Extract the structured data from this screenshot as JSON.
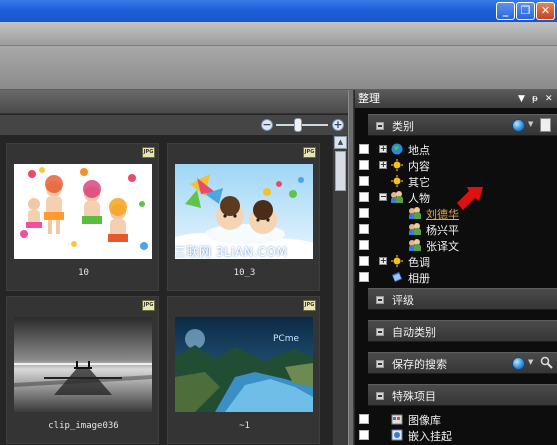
{
  "window": {
    "buttons": [
      {
        "glyph": "_",
        "name": "minimize"
      },
      {
        "glyph": "❐",
        "name": "restore"
      },
      {
        "glyph": "✕",
        "name": "close"
      }
    ]
  },
  "browser": {
    "zoom": {
      "minus": "−",
      "plus": "+"
    },
    "thumbnails": [
      {
        "caption": "10",
        "format": "JPG"
      },
      {
        "caption": "10_3",
        "format": "JPG"
      },
      {
        "caption": "clip_image036",
        "format": "JPG"
      },
      {
        "caption": "~1",
        "format": "JPG"
      }
    ],
    "watermark": "三联网 3LIAN.COM",
    "photo_logo": "PCme"
  },
  "organize": {
    "title": "整理",
    "controls": {
      "dropdown": "▼",
      "pin": "ᵽ",
      "close": "✕"
    },
    "sections": {
      "categories": "类别",
      "ratings": "评级",
      "auto_categories": "自动类别",
      "saved_searches": "保存的搜索",
      "special_items": "特殊项目"
    },
    "category_tree": [
      {
        "label": "地点",
        "icon": "globe-icon",
        "expander": "+"
      },
      {
        "label": "内容",
        "icon": "sun-icon",
        "expander": "+"
      },
      {
        "label": "其它",
        "icon": "sun-icon",
        "expander": ""
      },
      {
        "label": "人物",
        "icon": "people-icon",
        "expander": "−"
      },
      {
        "label": "刘德华",
        "icon": "people-icon",
        "expander": "",
        "selected": true
      },
      {
        "label": "杨兴平",
        "icon": "people-icon",
        "expander": ""
      },
      {
        "label": "张译文",
        "icon": "people-icon",
        "expander": ""
      },
      {
        "label": "色调",
        "icon": "sun-icon",
        "expander": "+"
      },
      {
        "label": "相册",
        "icon": "album-icon",
        "expander": ""
      }
    ],
    "special_items": [
      {
        "label": "图像库",
        "icon": "library-icon"
      },
      {
        "label": "嵌入挂起",
        "icon": "embed-pending-icon"
      }
    ]
  },
  "colors": {
    "titlebar": "#1d5fd9",
    "selected_text": "#e8a94a",
    "annotation_arrow": "#e01010"
  }
}
